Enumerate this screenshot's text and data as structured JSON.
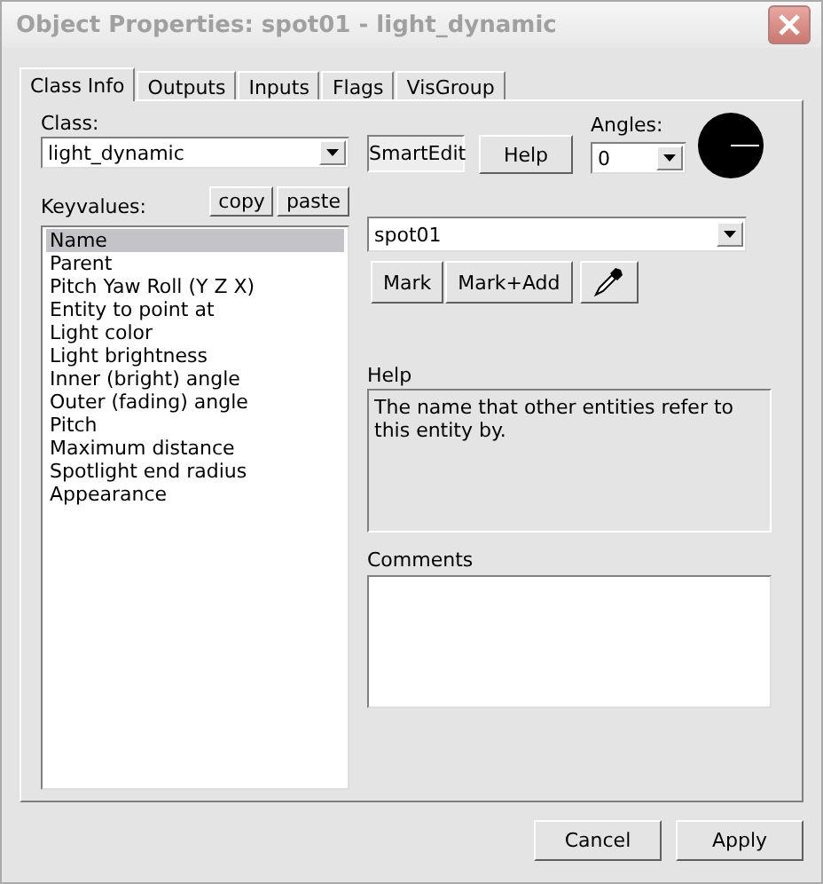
{
  "window": {
    "title": "Object Properties: spot01 - light_dynamic"
  },
  "tabs": [
    {
      "label": "Class Info",
      "selected": true
    },
    {
      "label": "Outputs",
      "selected": false
    },
    {
      "label": "Inputs",
      "selected": false
    },
    {
      "label": "Flags",
      "selected": false
    },
    {
      "label": "VisGroup",
      "selected": false
    }
  ],
  "class": {
    "label": "Class:",
    "value": "light_dynamic"
  },
  "smart_edit": {
    "label": "SmartEdit",
    "on": true
  },
  "help_button": "Help",
  "angles": {
    "label": "Angles:",
    "value": "0"
  },
  "keyvalues": {
    "label": "Keyvalues:",
    "copy": "copy",
    "paste": "paste",
    "items": [
      {
        "label": "Name",
        "selected": true
      },
      {
        "label": "Parent",
        "selected": false
      },
      {
        "label": "Pitch Yaw Roll (Y Z X)",
        "selected": false
      },
      {
        "label": "Entity to point at",
        "selected": false
      },
      {
        "label": "Light color",
        "selected": false
      },
      {
        "label": "Light brightness",
        "selected": false
      },
      {
        "label": "Inner (bright) angle",
        "selected": false
      },
      {
        "label": "Outer (fading) angle",
        "selected": false
      },
      {
        "label": "Pitch",
        "selected": false
      },
      {
        "label": "Maximum distance",
        "selected": false
      },
      {
        "label": "Spotlight end radius",
        "selected": false
      },
      {
        "label": "Appearance",
        "selected": false
      }
    ]
  },
  "value": "spot01",
  "mark_buttons": [
    "Mark",
    "Mark+Add"
  ],
  "help": {
    "label": "Help",
    "text": "The name that other entities refer to this entity by."
  },
  "comments": {
    "label": "Comments"
  },
  "buttons": [
    "Cancel",
    "Apply"
  ]
}
